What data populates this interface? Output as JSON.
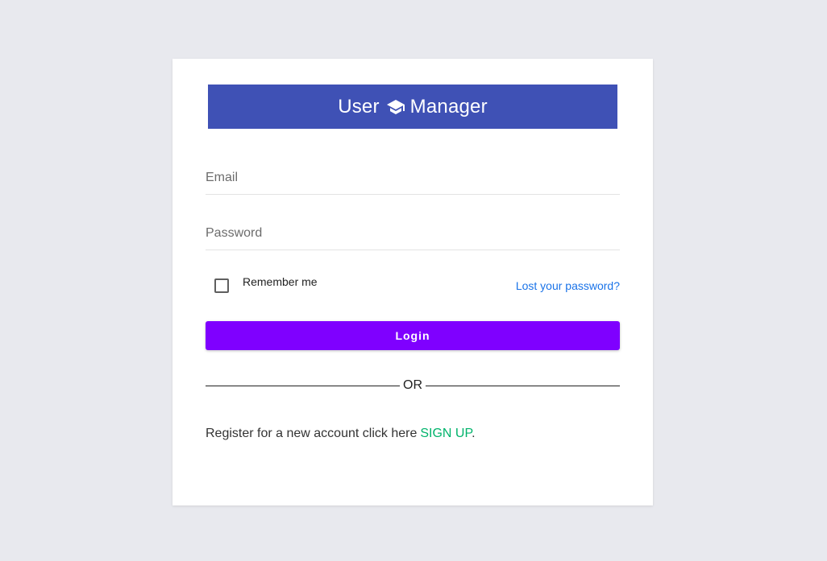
{
  "header": {
    "title_left": "User",
    "title_right": "Manager",
    "icon": "graduation-cap-icon",
    "background": "#3f51b5"
  },
  "form": {
    "email_placeholder": "Email",
    "password_placeholder": "Password",
    "remember_label": "Remember me",
    "remember_checked": false,
    "lost_password": "Lost your password?",
    "login_label": "Login",
    "login_color": "#7f00ff"
  },
  "divider": {
    "text": "OR"
  },
  "register": {
    "text": "Register for a new account click here",
    "signup_label": "SIGN UP",
    "suffix": ".",
    "signup_color": "#00b36b"
  }
}
